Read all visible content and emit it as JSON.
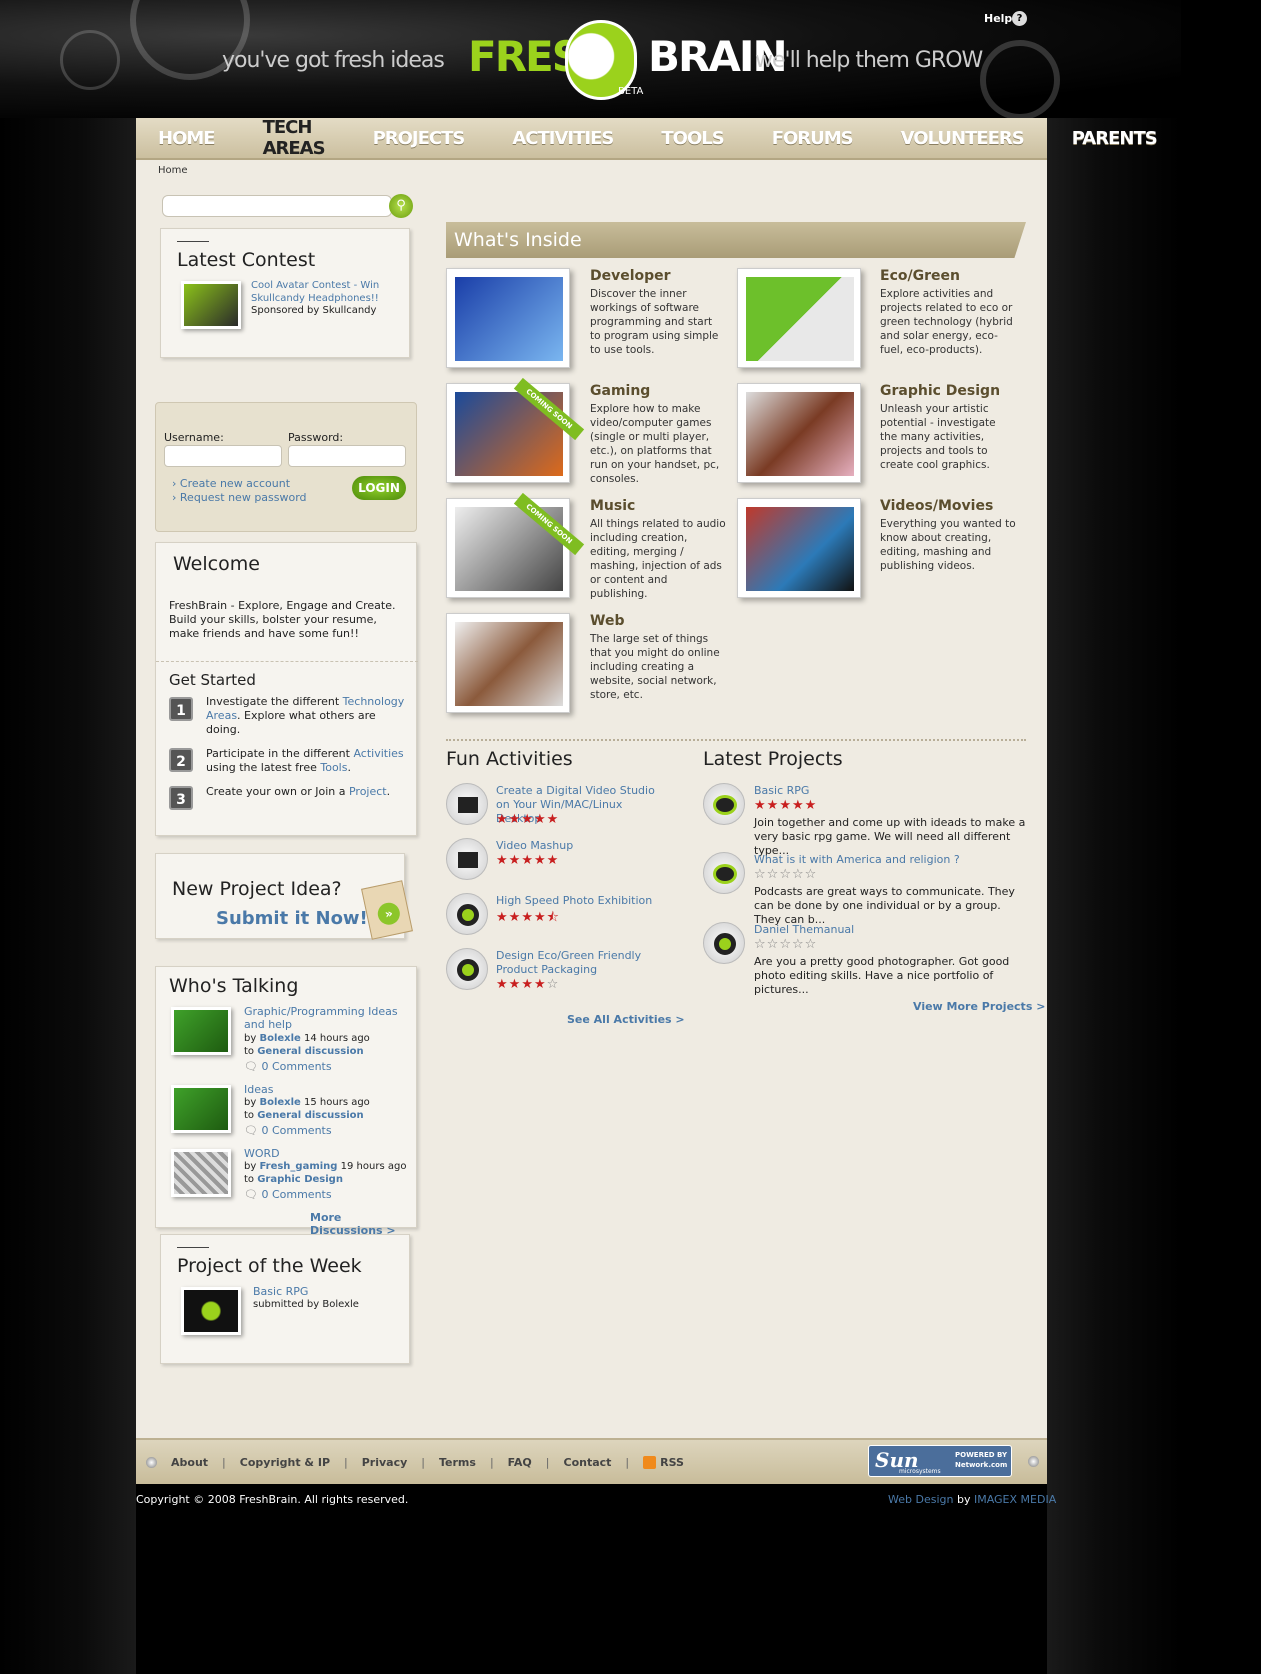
{
  "header": {
    "tagline_left": "you've got fresh ideas",
    "tagline_right": "we'll help them GROW",
    "logo_word1": "FRESH",
    "logo_word2": "BRAIN",
    "logo_beta": "BETA",
    "help_label": "Help",
    "help_icon": "question-icon"
  },
  "nav": {
    "items": [
      "HOME",
      "TECH AREAS",
      "PROJECTS",
      "ACTIVITIES",
      "TOOLS",
      "FORUMS",
      "VOLUNTEERS",
      "PARENTS"
    ],
    "active": "TECH AREAS"
  },
  "breadcrumb": "Home",
  "search": {
    "placeholder": "",
    "button_icon": "search-icon"
  },
  "latest_contest": {
    "title": "Latest Contest",
    "link": "Cool Avatar Contest - Win Skullcandy Headphones!!",
    "sponsor": "Sponsored by Skullcandy"
  },
  "login": {
    "username_label": "Username:",
    "password_label": "Password:",
    "create_account": "Create new account",
    "request_password": "Request new password",
    "button": "LOGIN"
  },
  "welcome": {
    "title": "Welcome",
    "text": "FreshBrain - Explore, Engage and Create. Build your skills, bolster your resume, make friends and have some fun!!",
    "get_started": "Get Started",
    "steps": [
      {
        "num": "1",
        "pre": "Investigate the different ",
        "link": "Technology Areas",
        "post": ". Explore what others are doing."
      },
      {
        "num": "2",
        "pre": "Participate in the different ",
        "link": "Activities",
        "mid": " using the latest free ",
        "link2": "Tools",
        "post": "."
      },
      {
        "num": "3",
        "pre": "Create your own or Join a ",
        "link": "Project",
        "post": "."
      }
    ]
  },
  "new_project": {
    "line1": "New Project Idea?",
    "line2": "Submit it Now!"
  },
  "whos_talking": {
    "title": "Who's Talking",
    "items": [
      {
        "title": "Graphic/Programming Ideas and help",
        "by": "by ",
        "user": "Bolexle",
        "time": " 14 hours ago",
        "to": "to ",
        "forum": "General discussion",
        "comments": "0 Comments"
      },
      {
        "title": "Ideas",
        "by": "by ",
        "user": "Bolexle",
        "time": " 15 hours ago",
        "to": "to ",
        "forum": "General discussion",
        "comments": "0 Comments"
      },
      {
        "title": "WORD",
        "by": "by ",
        "user": "Fresh_gaming",
        "time": " 19 hours ago",
        "to": "to ",
        "forum": "Graphic Design",
        "comments": "0 Comments"
      }
    ],
    "more": "More Discussions >"
  },
  "project_week": {
    "title": "Project of the Week",
    "link": "Basic RPG",
    "submitted": "submitted by Bolexle"
  },
  "whats_inside": {
    "title": "What's Inside",
    "categories": [
      {
        "name": "Developer",
        "desc": "Discover the inner workings of software programming and start to program using simple to use tools.",
        "coming_soon": false
      },
      {
        "name": "Eco/Green",
        "desc": "Explore activities and projects related to eco or green technology (hybrid and solar energy, eco-fuel, eco-products).",
        "coming_soon": false
      },
      {
        "name": "Gaming",
        "desc": "Explore how to make video/computer games (single or multi player, etc.), on platforms that run on your handset, pc, consoles.",
        "coming_soon": true
      },
      {
        "name": "Graphic Design",
        "desc": "Unleash your artistic potential - investigate the many activities, projects and tools to create cool graphics.",
        "coming_soon": false
      },
      {
        "name": "Music",
        "desc": "All things related to audio including creation, editing, merging / mashing, injection of ads or content and publishing.",
        "coming_soon": true
      },
      {
        "name": "Videos/Movies",
        "desc": "Everything you wanted to know about creating, editing, mashing and publishing videos.",
        "coming_soon": false
      },
      {
        "name": "Web",
        "desc": "The large set of things that you might do online including creating a website, social network, store, etc.",
        "coming_soon": false
      }
    ],
    "coming_soon_label": "COMING SOON"
  },
  "fun_activities": {
    "title": "Fun Activities",
    "items": [
      {
        "title": "Create a Digital Video Studio on Your Win/MAC/Linux Desktop",
        "rating": 5,
        "icon": "clapperboard-icon"
      },
      {
        "title": "Video Mashup",
        "rating": 5,
        "icon": "clapperboard-icon"
      },
      {
        "title": "High Speed Photo Exhibition",
        "rating": 4.5,
        "icon": "camera-lens-icon"
      },
      {
        "title": "Design Eco/Green Friendly Product Packaging",
        "rating": 4,
        "icon": "camera-lens-icon"
      }
    ],
    "see_all": "See All Activities >"
  },
  "latest_projects": {
    "title": "Latest Projects",
    "items": [
      {
        "title": "Basic RPG",
        "rating": 5,
        "desc": "Join together and come up with ideads to make a very basic rpg game. We will need all different type...",
        "icon": "controller-icon"
      },
      {
        "title": "What is it with America and religion ?",
        "rating": 0,
        "desc": "Podcasts are great ways to communicate. They can be done by one individual or by a group. They can b...",
        "icon": "controller-icon"
      },
      {
        "title": "Daniel Themanual",
        "rating": 0,
        "desc": "Are you a pretty good photographer. Got good photo editing skills. Have a nice portfolio of pictures...",
        "icon": "camera-lens-icon"
      }
    ],
    "view_more": "View More Projects >"
  },
  "footer": {
    "links": [
      "About",
      "Copyright & IP",
      "Privacy",
      "Terms",
      "FAQ",
      "Contact",
      "RSS"
    ],
    "sun_logo": "Sun",
    "sun_sub": "microsystems",
    "powered_by": "POWERED BY",
    "powered_site": "Network.com",
    "copyright": "Copyright © 2008 FreshBrain. All rights reserved.",
    "design_link": "Web Design",
    "design_by": " by ",
    "design_company": "IMAGEX MEDIA"
  },
  "colors": {
    "accent_green": "#9bd21c",
    "link_blue": "#4a79a8",
    "star_red": "#c81f1f",
    "page_bg": "#efebe2"
  }
}
